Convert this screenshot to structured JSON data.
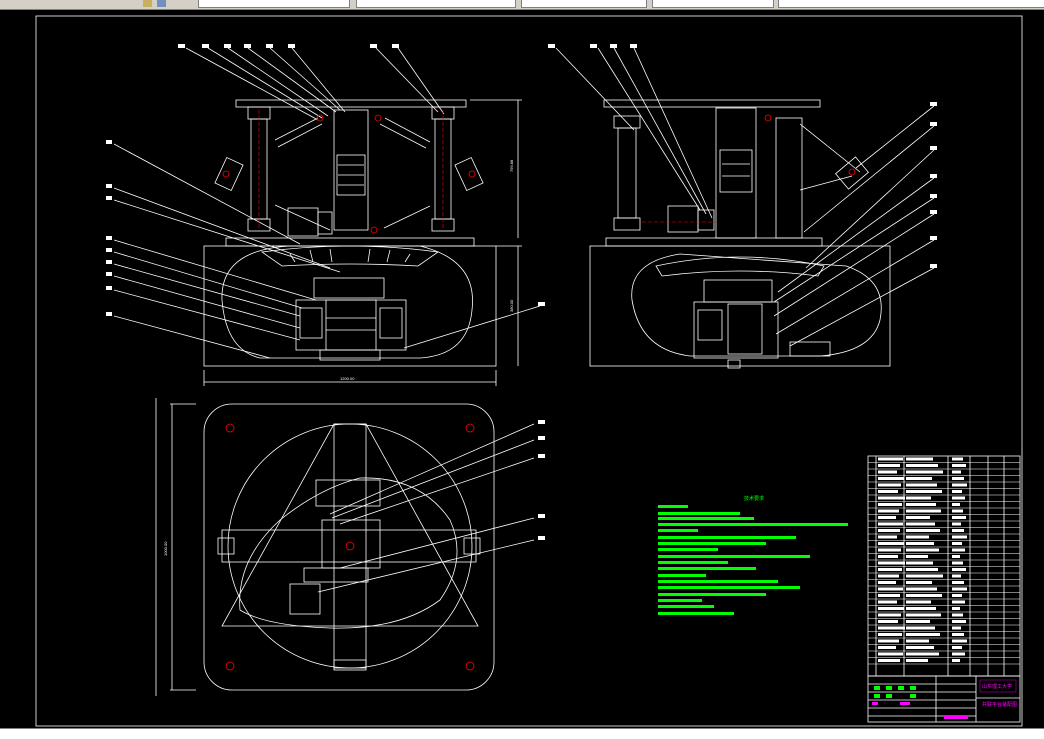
{
  "app": {
    "toolbar": {
      "fields": [
        "",
        "",
        "",
        "",
        "",
        ""
      ]
    },
    "command_line": {
      "prompt": "",
      "value": ""
    }
  },
  "drawing": {
    "dimensions": {
      "front_height": "799.88",
      "front_base_height": "380.00",
      "front_width": "1200.00",
      "plan_height": "1000.00"
    },
    "tech_notes": {
      "title": "技术要求"
    },
    "title_block": {
      "school": "山东理工大学",
      "drawing_name": "并联平台装配图"
    },
    "colors": {
      "lines": "#ffffff",
      "notes": "#00ff00",
      "holes": "#ff0000",
      "title_text": "#ff00ff",
      "axis": "#ff0000"
    }
  }
}
